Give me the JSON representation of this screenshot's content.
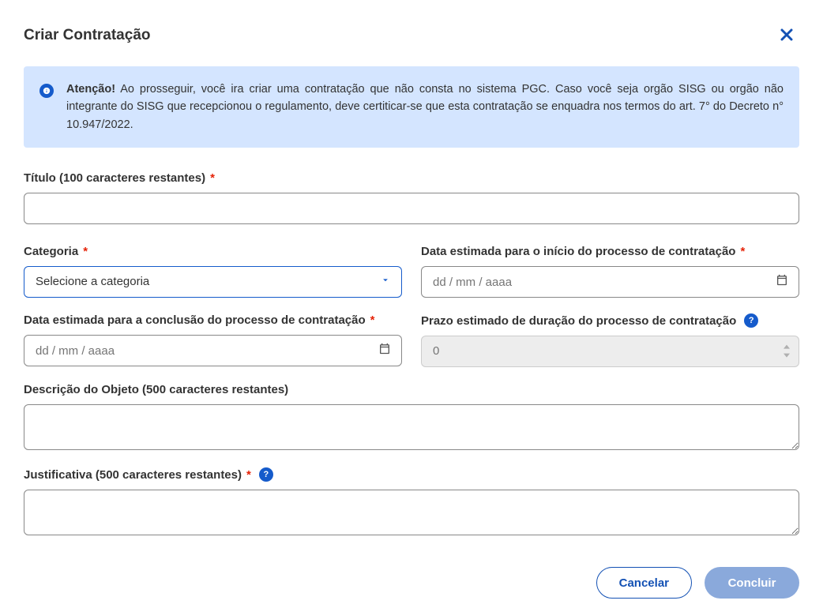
{
  "modal": {
    "title": "Criar Contratação"
  },
  "alert": {
    "bold": "Atenção!",
    "text": " Ao prosseguir, você ira criar uma contratação que não consta no sistema PGC. Caso você seja orgão SISG ou orgão não integrante do SISG que recepcionou o regulamento, deve certiticar-se que esta contratação se enquadra nos termos do art. 7° do Decreto n° 10.947/2022."
  },
  "fields": {
    "titulo": {
      "label": "Título (100 caracteres restantes)",
      "value": ""
    },
    "categoria": {
      "label": "Categoria",
      "selected": "Selecione a categoria"
    },
    "dataInicio": {
      "label": "Data estimada para o início do processo de contratação",
      "placeholder": "dd / mm / aaaa"
    },
    "dataConclusao": {
      "label": "Data estimada para a conclusão do processo de contratação",
      "placeholder": "dd / mm / aaaa"
    },
    "prazo": {
      "label": "Prazo estimado de duração do processo de contratação",
      "value": "0"
    },
    "descricao": {
      "label": "Descrição do Objeto (500 caracteres restantes)",
      "value": ""
    },
    "justificativa": {
      "label": "Justificativa (500 caracteres restantes)",
      "value": ""
    }
  },
  "buttons": {
    "cancel": "Cancelar",
    "confirm": "Concluir"
  },
  "symbols": {
    "required": "*",
    "help": "?"
  }
}
